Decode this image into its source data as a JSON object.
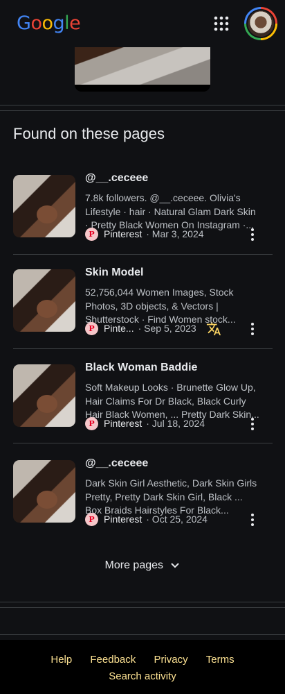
{
  "header": {
    "logo": "Google",
    "apps_icon": "apps-grid-icon",
    "avatar": "account-avatar"
  },
  "section": {
    "title": "Found on these pages"
  },
  "results": [
    {
      "title": "@__.ceceee",
      "snippet": "7.8k followers. @__.ceceee. Olivia's Lifestyle · hair · Natural Glam Dark Skin · Pretty Black Women On Instagram ·...",
      "source": "Pinterest",
      "date": "· Mar 3, 2024",
      "translated": false
    },
    {
      "title": "Skin Model",
      "snippet": "52,756,044 Women Images, Stock Photos, 3D objects, & Vectors | Shutterstock · Find Women stock...",
      "source": "Pinte...",
      "date": "· Sep 5, 2023",
      "translated": true
    },
    {
      "title": "Black Woman Baddie",
      "snippet": "Soft Makeup Looks · Brunette Glow Up, Hair Claims For Dr Black, Black Curly Hair Black Women, ... Pretty Dark Skin...",
      "source": "Pinterest",
      "date": "· Jul 18, 2024",
      "translated": false
    },
    {
      "title": "@__.ceceee",
      "snippet": "Dark Skin Girl Aesthetic, Dark Skin Girls Pretty, Pretty Dark Skin Girl, Black ... Box Braids Hairstyles For Black...",
      "source": "Pinterest",
      "date": "· Oct 25, 2024",
      "translated": false
    }
  ],
  "more_pages": {
    "label": "More pages"
  },
  "footer": {
    "links": [
      "Help",
      "Feedback",
      "Privacy",
      "Terms"
    ],
    "activity": "Search activity"
  },
  "colors": {
    "background": "#101114",
    "divider": "#3c4043",
    "footer_link": "#fde293",
    "translate_icon": "#fdd663"
  }
}
